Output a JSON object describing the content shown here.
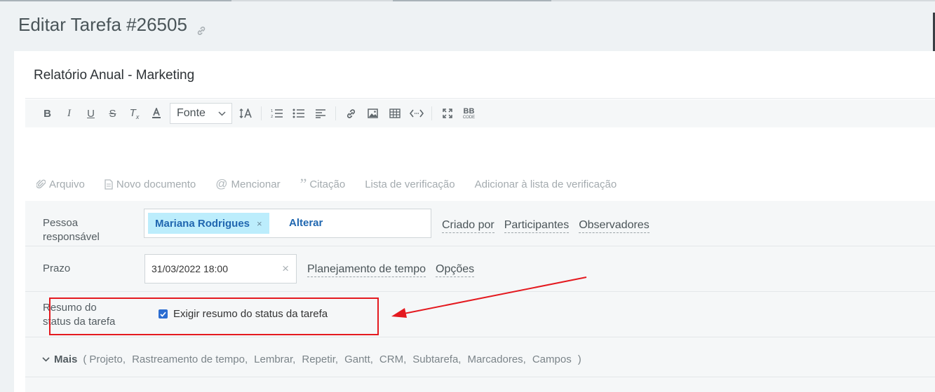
{
  "page_title": "Editar Tarefa #26505",
  "task_title": "Relatório Anual - Marketing",
  "toolbar": {
    "bold": "B",
    "italic": "I",
    "underline": "U",
    "strike": "S",
    "clear_format": "T",
    "font_select": "Fonte",
    "bbcode": "BB",
    "bbcode_sub": "CODE"
  },
  "attachments": {
    "file": "Arquivo",
    "new_doc": "Novo documento",
    "mention": "Mencionar",
    "quote": "Citação",
    "checklist": "Lista de verificação",
    "add_checklist": "Adicionar à lista de verificação"
  },
  "responsible": {
    "label_line1": "Pessoa",
    "label_line2": "responsável",
    "person": "Mariana Rodrigues",
    "remove": "×",
    "change": "Alterar",
    "links": [
      "Criado por",
      "Participantes",
      "Observadores"
    ]
  },
  "deadline": {
    "label": "Prazo",
    "value": "31/03/2022 18:00",
    "clear": "×",
    "links": [
      "Planejamento de tempo",
      "Opções"
    ]
  },
  "status_summary": {
    "label_line1": "Resumo do",
    "label_line2": "status da tarefa",
    "checkbox_label": "Exigir resumo do status da tarefa",
    "checked": true
  },
  "more": {
    "label": "Mais",
    "open": "(",
    "items": [
      "Projeto,",
      "Rastreamento de tempo,",
      "Lembrar,",
      "Repetir,",
      "Gantt,",
      "CRM,",
      "Subtarefa,",
      "Marcadores,",
      "Campos"
    ],
    "close": ")"
  },
  "colors": {
    "highlight": "#e4191f",
    "tag_bg": "#bcedfc",
    "link_blue": "#2067b0"
  }
}
